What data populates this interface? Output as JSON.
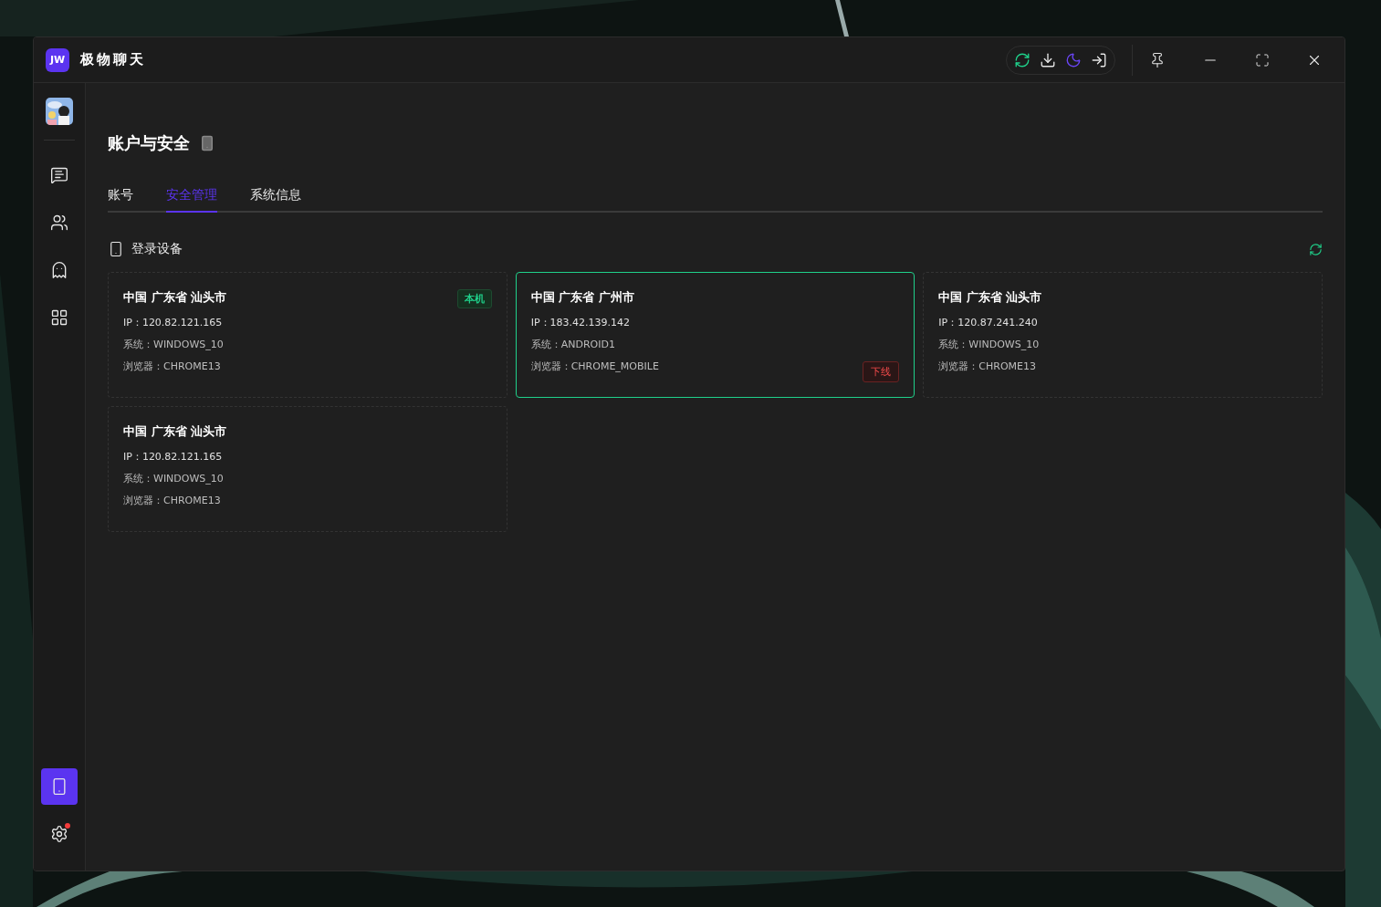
{
  "window": {
    "logo": "JW",
    "title": "极物聊天"
  },
  "toolbar": [
    {
      "kind": "sync"
    },
    {
      "kind": "download"
    },
    {
      "kind": "theme"
    },
    {
      "kind": "logout"
    }
  ],
  "sidebar": {
    "items": [
      {
        "kind": "chat",
        "selected": false
      },
      {
        "kind": "contacts",
        "selected": false
      },
      {
        "kind": "ghost",
        "selected": false
      },
      {
        "kind": "apps",
        "selected": false
      }
    ],
    "bottom": [
      {
        "kind": "devices",
        "selected": true,
        "dot": false
      },
      {
        "kind": "settings",
        "selected": false,
        "dot": true
      }
    ]
  },
  "page": {
    "title": "账户与安全"
  },
  "tabs": [
    {
      "label": "账号",
      "selected": false
    },
    {
      "label": "安全管理",
      "selected": true
    },
    {
      "label": "系统信息",
      "selected": false
    }
  ],
  "section": {
    "title": "登录设备"
  },
  "devices": [
    {
      "location": "中国 广东省 汕头市",
      "ip": "IP：120.82.121.165",
      "system": "系统：WINDOWS_10",
      "browser": "浏览器：CHROME13",
      "badge": "本机",
      "selected": false
    },
    {
      "location": "中国 广东省 广州市",
      "ip": "IP：183.42.139.142",
      "system": "系统：ANDROID1",
      "browser": "浏览器：CHROME_MOBILE",
      "action": "下线",
      "selected": true
    },
    {
      "location": "中国 广东省 汕头市",
      "ip": "IP：120.87.241.240",
      "system": "系统：WINDOWS_10",
      "browser": "浏览器：CHROME13",
      "selected": false
    },
    {
      "location": "中国 广东省 汕头市",
      "ip": "IP：120.82.121.165",
      "system": "系统：WINDOWS_10",
      "browser": "浏览器：CHROME13",
      "selected": false
    }
  ]
}
